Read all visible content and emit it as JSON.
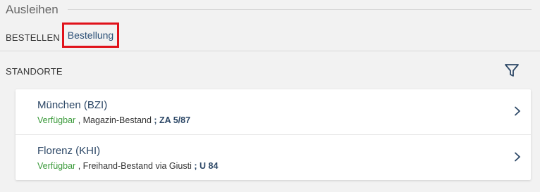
{
  "section": {
    "title": "Ausleihen"
  },
  "request": {
    "label": "BESTELLEN",
    "link": "Bestellung",
    "highlight_color": "#e0121a"
  },
  "locations": {
    "label": "STANDORTE",
    "filter_icon": "filter-icon",
    "items": [
      {
        "name": "München (BZI)",
        "availability": "Verfügbar",
        "sep": " , ",
        "collection": "Magazin-Bestand",
        "callno": " ; ZA 5/87"
      },
      {
        "name": "Florenz (KHI)",
        "availability": "Verfügbar",
        "sep": " , ",
        "collection": "Freihand-Bestand via Giusti",
        "callno": " ; U 84"
      }
    ]
  },
  "colors": {
    "available": "#3a9a3a",
    "link": "#2c5077",
    "background": "#f2f2f2"
  }
}
